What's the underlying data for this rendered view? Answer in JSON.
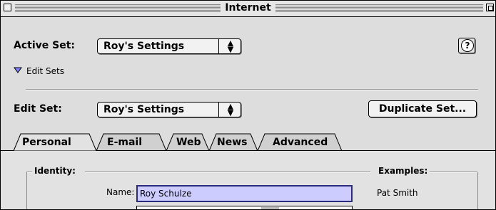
{
  "window": {
    "title": "Internet"
  },
  "active_set": {
    "label": "Active Set:",
    "value": "Roy's Settings"
  },
  "help": {
    "glyph": "?"
  },
  "edit_sets": {
    "label": "Edit Sets"
  },
  "edit_set": {
    "label": "Edit Set:",
    "value": "Roy's Settings"
  },
  "duplicate_button": {
    "label": "Duplicate Set..."
  },
  "tabs": [
    {
      "label": "Personal",
      "selected": true
    },
    {
      "label": "E-mail",
      "selected": false
    },
    {
      "label": "Web",
      "selected": false
    },
    {
      "label": "News",
      "selected": false
    },
    {
      "label": "Advanced",
      "selected": false
    }
  ],
  "identity": {
    "group_label": "Identity:",
    "name_label": "Name:",
    "name_value": "Roy Schulze"
  },
  "examples": {
    "group_label": "Examples:",
    "name_example": "Pat Smith"
  },
  "popup_arrows": "▲▼"
}
